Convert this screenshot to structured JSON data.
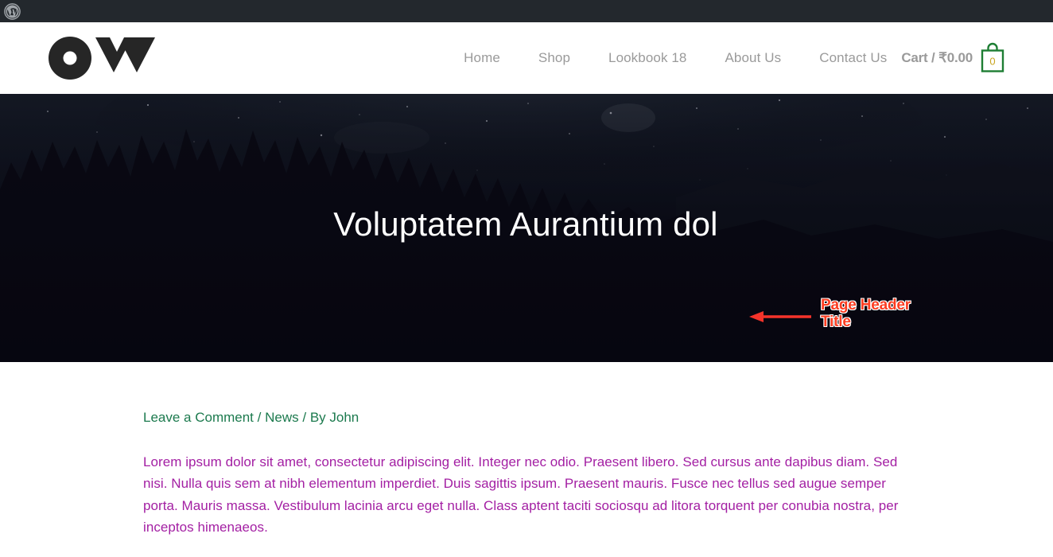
{
  "admin_bar": {
    "wp_logo_icon": "wordpress-logo-icon",
    "background": "#23282d"
  },
  "header": {
    "logo_icon": "ow-brand-logo-icon",
    "nav": [
      {
        "label": "Home"
      },
      {
        "label": "Shop"
      },
      {
        "label": "Lookbook 18"
      },
      {
        "label": "About Us"
      },
      {
        "label": "Contact Us"
      }
    ],
    "cart": {
      "label": "Cart / ₹0.00",
      "count": "0",
      "icon": "shopping-bag-icon",
      "accent": "#1e7e34"
    },
    "nav_color": "#9a9a9a"
  },
  "hero": {
    "title": "Voluptatem Aurantium dol",
    "background_alt": "night-sky-forest-mountains",
    "title_color": "#ffffff"
  },
  "annotation": {
    "text": "Page Header Title",
    "line1": "Page Header",
    "line2": "Title",
    "color": "#fc3d21",
    "outline": "#ffffff",
    "arrow_icon": "left-arrow-icon"
  },
  "post": {
    "meta": {
      "comment_link": "Leave a Comment",
      "separator_1": "/",
      "category": "News",
      "separator_2": "/",
      "byline": "By John",
      "color": "#1c7a4e"
    },
    "body": "Lorem ipsum dolor sit amet, consectetur adipiscing elit. Integer nec odio. Praesent libero. Sed cursus ante dapibus diam. Sed nisi. Nulla quis sem at nibh elementum imperdiet. Duis sagittis ipsum. Praesent mauris. Fusce nec tellus sed augue semper porta. Mauris massa. Vestibulum lacinia arcu eget nulla. Class aptent taciti sociosqu ad litora torquent per conubia nostra, per inceptos himenaeos.",
    "body_color": "#a31fa3"
  }
}
